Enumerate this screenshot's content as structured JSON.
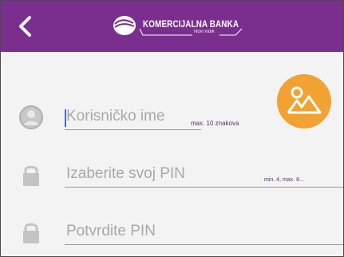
{
  "header": {
    "bank_name": "KOMERCIJALNA BANKA",
    "tagline": "Novi vidik",
    "colors": {
      "bar": "#7a2f8f",
      "accent": "#f2a233",
      "caret": "#3a6bd8"
    }
  },
  "form": {
    "username": {
      "placeholder": "Korisničko ime",
      "hint": "max. 10 znakova",
      "icon": "user-icon"
    },
    "pin": {
      "placeholder": "Izaberite svoj PIN",
      "hint": "min. 4, max. 8...",
      "icon": "lock-icon"
    },
    "pin_confirm": {
      "placeholder": "Potvrdite PIN",
      "icon": "lock-icon"
    }
  },
  "photo_button": {
    "icon": "image-icon"
  }
}
